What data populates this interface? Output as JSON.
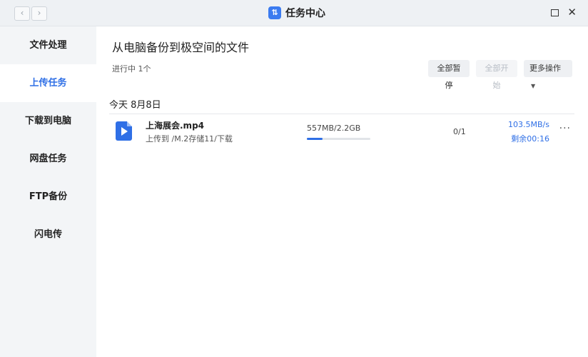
{
  "window": {
    "title": "任务中心",
    "app_icon": "task-center-icon",
    "nav_back": "‹",
    "nav_forward": "›",
    "close_glyph": "✕"
  },
  "sidebar": {
    "items": [
      {
        "label": "文件处理",
        "active": false
      },
      {
        "label": "上传任务",
        "active": true
      },
      {
        "label": "下载到电脑",
        "active": false
      },
      {
        "label": "网盘任务",
        "active": false
      },
      {
        "label": "FTP备份",
        "active": false
      },
      {
        "label": "闪电传",
        "active": false
      }
    ]
  },
  "main": {
    "title": "从电脑备份到极空间的文件",
    "status": "进行中 1个",
    "buttons": {
      "pause_all": "全部暂停",
      "start_all": "全部开始",
      "more_actions": "更多操作"
    },
    "date_heading": "今天 8月8日",
    "task": {
      "file_name": "上海展会.mp4",
      "path": "上传到 /M.2存储11/下载",
      "size": "557MB/2.2GB",
      "progress": 0.25,
      "count": "0/1",
      "speed": "103.5MB/s",
      "remaining": "剩余00:16",
      "more_glyph": "···"
    }
  },
  "colors": {
    "accent": "#2f6fe6",
    "sidebar_bg": "#f3f5f7",
    "titlebar_bg": "#eef1f4"
  }
}
